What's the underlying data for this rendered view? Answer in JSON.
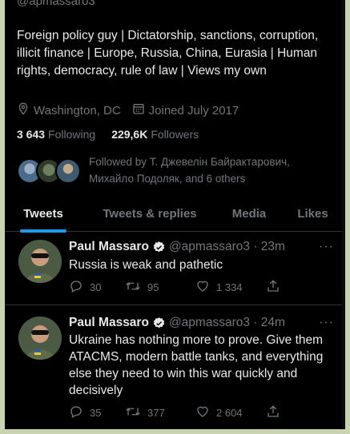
{
  "profile": {
    "handle": "@apmassaro3",
    "bio": "Foreign policy guy | Dictatorship, sanctions, corruption, illicit finance | Europe, Russia, China, Eurasia | Human rights, democracy, rule of law | Views my own",
    "location": "Washington, DC",
    "joined": "Joined July 2017",
    "following_count": "3 643",
    "following_label": "Following",
    "followers_count": "229,6K",
    "followers_label": "Followers",
    "followed_by": "Followed by Т. Джевелін Байрактарович, Михайло Подоляк, and 6 others"
  },
  "tabs": [
    {
      "label": "Tweets",
      "active": true
    },
    {
      "label": "Tweets & replies",
      "active": false
    },
    {
      "label": "Media",
      "active": false
    },
    {
      "label": "Likes",
      "active": false
    }
  ],
  "tweets": [
    {
      "name": "Paul Massaro",
      "user": "@apmassaro3 · 23m",
      "text": "Russia is weak and pathetic",
      "replies": "30",
      "retweets": "95",
      "likes": "1 334"
    },
    {
      "name": "Paul Massaro",
      "user": "@apmassaro3 · 24m",
      "text": "Ukraine has nothing more to prove. Give them ATACMS, modern battle tanks, and everything else they need to win this war quickly and decisively",
      "replies": "35",
      "retweets": "377",
      "likes": "2 604"
    }
  ],
  "icons": {
    "location": "location-pin-icon",
    "calendar": "calendar-icon",
    "verified": "verified-badge-icon",
    "reply": "reply-icon",
    "retweet": "retweet-icon",
    "like": "heart-icon",
    "share": "share-icon",
    "more": "more-icon"
  },
  "colors": {
    "background": "#000000",
    "text": "#e7e9ea",
    "muted": "#71767b",
    "accent": "#1d9bf0",
    "divider": "#2f3336",
    "outer_frame": "#c9d3b0"
  }
}
